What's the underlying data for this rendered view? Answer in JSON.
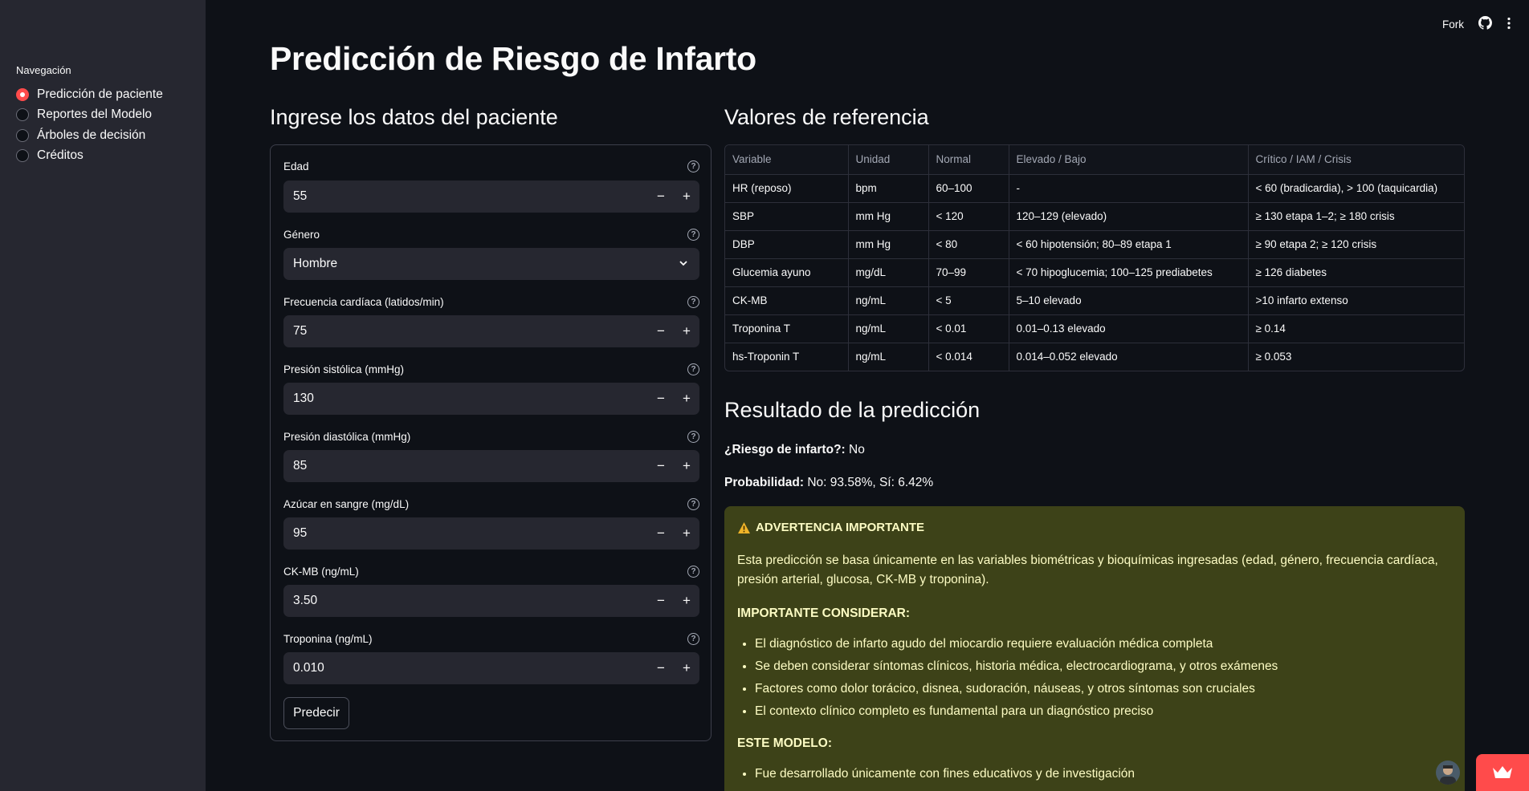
{
  "sidebar": {
    "title": "Navegación",
    "items": [
      {
        "label": "Predicción de paciente",
        "selected": true
      },
      {
        "label": "Reportes del Modelo",
        "selected": false
      },
      {
        "label": "Árboles de decisión",
        "selected": false
      },
      {
        "label": "Créditos",
        "selected": false
      }
    ]
  },
  "topbar": {
    "fork_label": "Fork",
    "icons": [
      "github-icon",
      "more-vertical-icon"
    ]
  },
  "page_title": "Predicción de Riesgo de Infarto",
  "form": {
    "heading": "Ingrese los datos del paciente",
    "fields": [
      {
        "label": "Edad",
        "value": "55",
        "type": "number"
      },
      {
        "label": "Género",
        "value": "Hombre",
        "type": "select"
      },
      {
        "label": "Frecuencia cardíaca (latidos/min)",
        "value": "75",
        "type": "number"
      },
      {
        "label": "Presión sistólica (mmHg)",
        "value": "130",
        "type": "number"
      },
      {
        "label": "Presión diastólica (mmHg)",
        "value": "85",
        "type": "number"
      },
      {
        "label": "Azúcar en sangre (mg/dL)",
        "value": "95",
        "type": "number"
      },
      {
        "label": "CK-MB (ng/mL)",
        "value": "3.50",
        "type": "number"
      },
      {
        "label": "Troponina (ng/mL)",
        "value": "0.010",
        "type": "number"
      }
    ],
    "help_glyph": "?",
    "minus_glyph": "−",
    "plus_glyph": "+",
    "submit_label": "Predecir"
  },
  "reference": {
    "heading": "Valores de referencia",
    "columns": [
      "Variable",
      "Unidad",
      "Normal",
      "Elevado / Bajo",
      "Crítico / IAM / Crisis"
    ],
    "rows": [
      [
        "HR (reposo)",
        "bpm",
        "60–100",
        "-",
        "< 60 (bradicardia), > 100 (taquicardia)"
      ],
      [
        "SBP",
        "mm Hg",
        "< 120",
        "120–129 (elevado)",
        "≥ 130 etapa 1–2; ≥ 180 crisis"
      ],
      [
        "DBP",
        "mm Hg",
        "< 80",
        "< 60 hipotensión; 80–89 etapa 1",
        "≥ 90 etapa 2; ≥ 120 crisis"
      ],
      [
        "Glucemia ayuno",
        "mg/dL",
        "70–99",
        "< 70 hipoglucemia; 100–125 prediabetes",
        "≥ 126 diabetes"
      ],
      [
        "CK-MB",
        "ng/mL",
        "< 5",
        "5–10 elevado",
        ">10 infarto extenso"
      ],
      [
        "Troponina T",
        "ng/mL",
        "< 0.01",
        "0.01–0.13 elevado",
        "≥ 0.14"
      ],
      [
        "hs-Troponin T",
        "ng/mL",
        "< 0.014",
        "0.014–0.052 elevado",
        "≥ 0.053"
      ]
    ]
  },
  "result": {
    "heading": "Resultado de la predicción",
    "risk_label": "¿Riesgo de infarto?:",
    "risk_value": "No",
    "prob_label": "Probabilidad:",
    "prob_value": "No: 93.58%, Sí: 6.42%"
  },
  "warning": {
    "title": "ADVERTENCIA IMPORTANTE",
    "intro": "Esta predicción se basa únicamente en las variables biométricas y bioquímicas ingresadas (edad, género, frecuencia cardíaca, presión arterial, glucosa, CK-MB y troponina).",
    "consider_heading": "IMPORTANTE CONSIDERAR:",
    "consider_items": [
      "El diagnóstico de infarto agudo del miocardio requiere evaluación médica completa",
      "Se deben considerar síntomas clínicos, historia médica, electrocardiograma, y otros exámenes",
      "Factores como dolor torácico, disnea, sudoración, náuseas, y otros síntomas son cruciales",
      "El contexto clínico completo es fundamental para un diagnóstico preciso"
    ],
    "model_heading": "ESTE MODELO:",
    "model_items": [
      "Fue desarrollado únicamente con fines educativos y de investigación"
    ]
  },
  "colors": {
    "accent": "#ff4b4b",
    "background": "#0e1117",
    "sidebar": "#262730",
    "warning_bg": "#3d4218",
    "warning_text": "#fdfcc4"
  }
}
